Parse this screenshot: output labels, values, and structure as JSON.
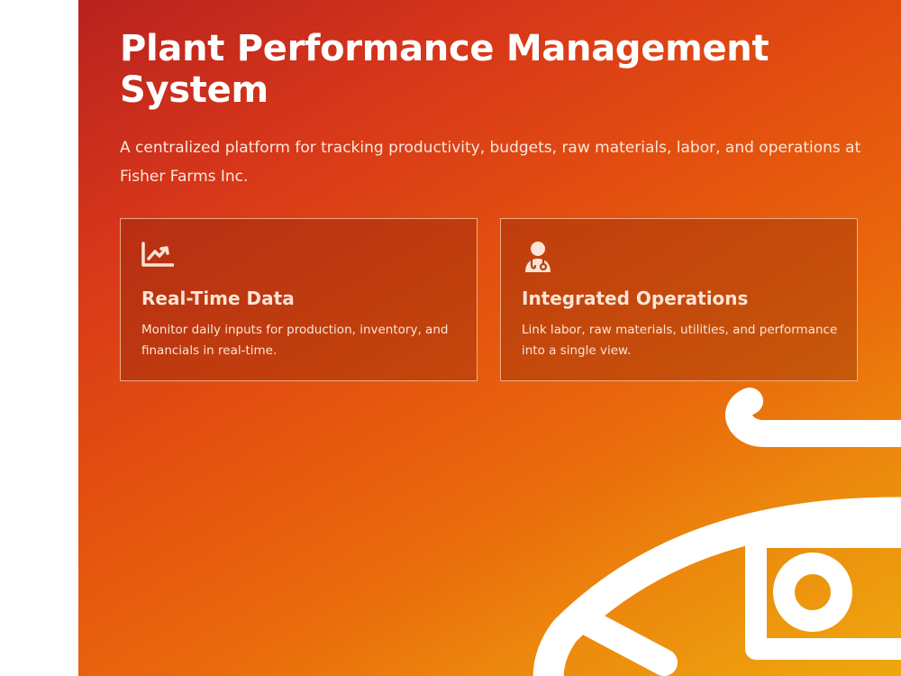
{
  "hero": {
    "title": "Plant Performance Management System",
    "subtitle": "A centralized platform for tracking productivity, budgets, raw materials, labor, and operations at Fisher Farms Inc."
  },
  "features": [
    {
      "icon": "trending-chart-icon",
      "title": "Real-Time Data",
      "description": "Monitor daily inputs for production, inventory, and financials in real-time."
    },
    {
      "icon": "user-doctor-icon",
      "title": "Integrated Operations",
      "description": "Link labor, raw materials, utilities, and performance into a single view."
    }
  ],
  "decoration": {
    "icon": "fish-outline-icon"
  },
  "colors": {
    "gradient_start": "#b8221f",
    "gradient_mid": "#e4510f",
    "gradient_end": "#eea80f",
    "text": "#ffffff"
  }
}
